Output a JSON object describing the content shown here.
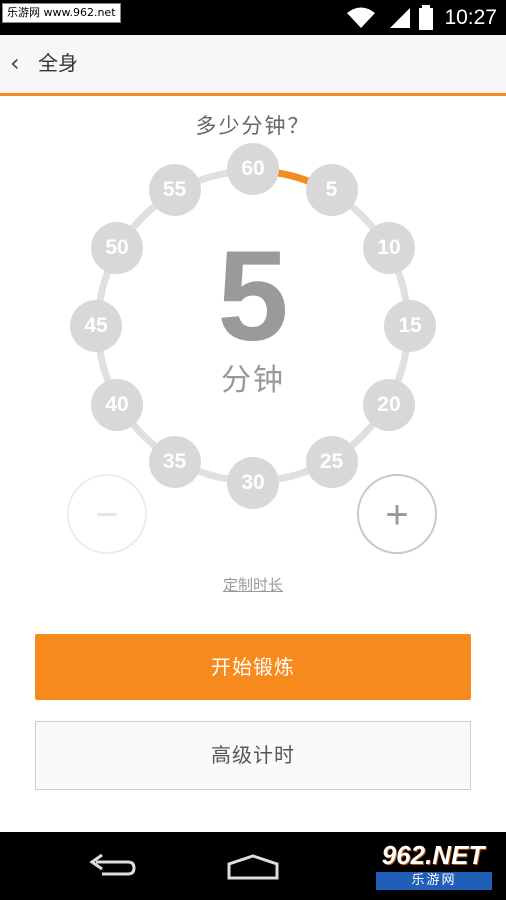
{
  "status_bar": {
    "watermark": "乐游网 www.962.net",
    "time": "10:27",
    "icons": [
      "wifi-icon",
      "signal-icon",
      "battery-icon"
    ]
  },
  "header": {
    "back_icon": "‹",
    "title": "全身"
  },
  "question": "多少分钟？",
  "dial": {
    "marks": [
      "60",
      "5",
      "10",
      "15",
      "20",
      "25",
      "30",
      "35",
      "40",
      "45",
      "50",
      "55"
    ],
    "selected_value": "5",
    "unit": "分钟",
    "progress_fraction": 0.0833,
    "accent_color": "#f28b20"
  },
  "controls": {
    "minus": "−",
    "plus": "+"
  },
  "custom_link": "定制时长",
  "buttons": {
    "start": "开始锻炼",
    "advanced": "高级计时"
  },
  "nav_logo": {
    "top": "962.NET",
    "bottom": "乐游网"
  },
  "colors": {
    "brand_orange": "#f78a1d",
    "bubble_gray": "#d8d8d8"
  }
}
